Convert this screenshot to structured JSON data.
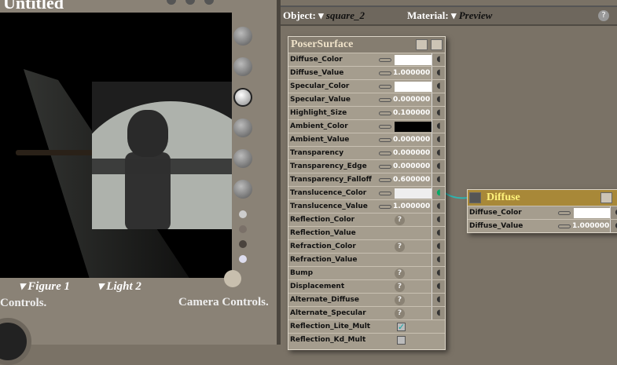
{
  "document": {
    "title": "Untitled"
  },
  "viewport": {
    "figure_menu": "Figure 1",
    "light_menu": "Light 2",
    "left_controls": "Controls.",
    "camera_controls": "Camera Controls."
  },
  "header": {
    "object_label": "Object:",
    "object_value": "square_2",
    "material_label": "Material:",
    "material_value": "Preview",
    "help": "?"
  },
  "poser_surface": {
    "title": "PoserSurface",
    "rows": [
      {
        "label": "Diffuse_Color",
        "type": "color",
        "color": "#ffffff"
      },
      {
        "label": "Diffuse_Value",
        "type": "value",
        "value": "1.000000"
      },
      {
        "label": "Specular_Color",
        "type": "color",
        "color": "#ffffff"
      },
      {
        "label": "Specular_Value",
        "type": "value",
        "value": "0.000000"
      },
      {
        "label": "Highlight_Size",
        "type": "value",
        "value": "0.100000"
      },
      {
        "label": "Ambient_Color",
        "type": "color",
        "color": "#000000"
      },
      {
        "label": "Ambient_Value",
        "type": "value",
        "value": "0.000000"
      },
      {
        "label": "Transparency",
        "type": "value",
        "value": "0.000000"
      },
      {
        "label": "Transparency_Edge",
        "type": "value",
        "value": "0.000000"
      },
      {
        "label": "Transparency_Falloff",
        "type": "value",
        "value": "0.600000"
      },
      {
        "label": "Translucence_Color",
        "type": "color",
        "color": "#eeeeee",
        "connected": true
      },
      {
        "label": "Translucence_Value",
        "type": "value",
        "value": "1.000000"
      },
      {
        "label": "Reflection_Color",
        "type": "help"
      },
      {
        "label": "Reflection_Value",
        "type": "none"
      },
      {
        "label": "Refraction_Color",
        "type": "help"
      },
      {
        "label": "Refraction_Value",
        "type": "none"
      },
      {
        "label": "Bump",
        "type": "help"
      },
      {
        "label": "Displacement",
        "type": "help"
      },
      {
        "label": "Alternate_Diffuse",
        "type": "help"
      },
      {
        "label": "Alternate_Specular",
        "type": "help"
      },
      {
        "label": "Reflection_Lite_Mult",
        "type": "checkbox",
        "checked": true
      },
      {
        "label": "Reflection_Kd_Mult",
        "type": "checkbox",
        "checked": false
      }
    ]
  },
  "diffuse_node": {
    "title": "Diffuse",
    "rows": [
      {
        "label": "Diffuse_Color",
        "type": "color",
        "color": "#ffffff"
      },
      {
        "label": "Diffuse_Value",
        "type": "value",
        "value": "1.000000"
      }
    ]
  },
  "colors": {
    "wire": "#2fb5b0",
    "diffuse_header": "#a88838"
  }
}
